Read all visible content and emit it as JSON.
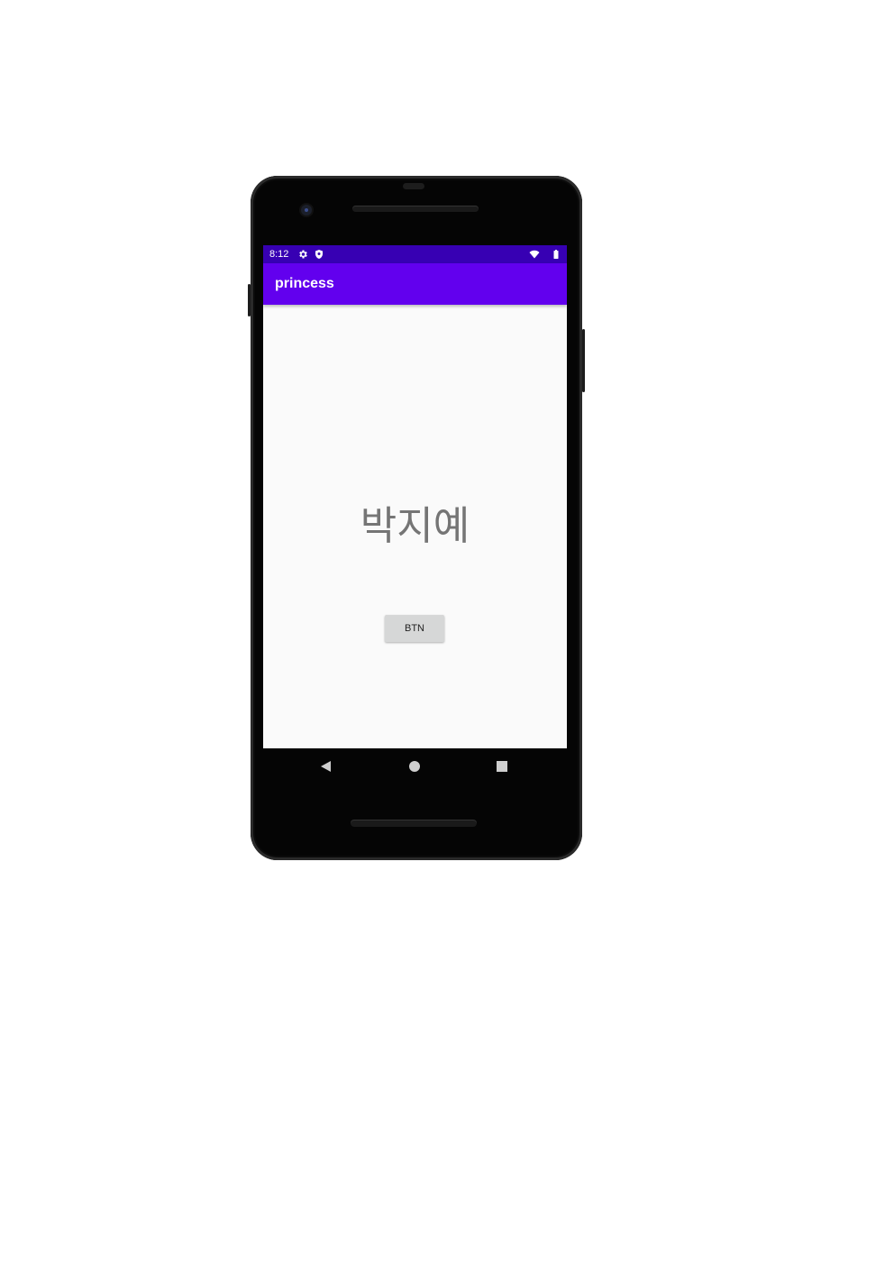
{
  "status_bar": {
    "time": "8:12",
    "left_icons": [
      "settings-gear-icon",
      "shield-icon"
    ],
    "right_icons": [
      "wifi-icon",
      "battery-icon"
    ],
    "color": "#3700b3"
  },
  "app_bar": {
    "title": "princess",
    "color": "#6200ee"
  },
  "content": {
    "name_text": "박지예",
    "button_label": "BTN",
    "background": "#fafafa"
  },
  "nav_bar": {
    "buttons": [
      "back-triangle-icon",
      "home-circle-icon",
      "recents-square-icon"
    ]
  }
}
